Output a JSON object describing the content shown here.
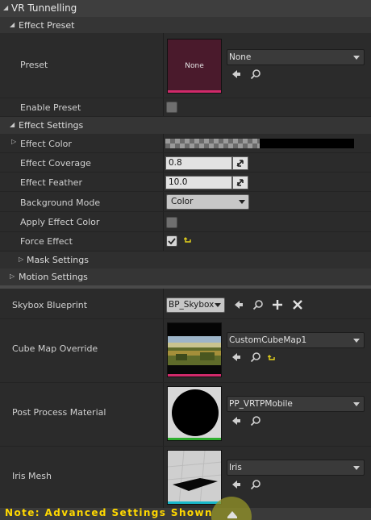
{
  "title": "VR Tunnelling",
  "sections": {
    "effect_preset": "Effect Preset",
    "effect_settings": "Effect Settings",
    "mask_settings": "Mask Settings",
    "motion_settings": "Motion Settings"
  },
  "preset": {
    "label": "Preset",
    "thumb_text": "None",
    "value": "None"
  },
  "enable_preset": {
    "label": "Enable Preset",
    "checked": false
  },
  "effect_color": {
    "label": "Effect Color",
    "color": "#000000"
  },
  "effect_coverage": {
    "label": "Effect Coverage",
    "value": "0.8"
  },
  "effect_feather": {
    "label": "Effect Feather",
    "value": "10.0"
  },
  "background_mode": {
    "label": "Background Mode",
    "value": "Color"
  },
  "apply_effect_color": {
    "label": "Apply Effect Color",
    "checked": false
  },
  "force_effect": {
    "label": "Force Effect",
    "checked": true
  },
  "skybox_blueprint": {
    "label": "Skybox Blueprint",
    "value": "BP_Skybox"
  },
  "cube_map_override": {
    "label": "Cube Map Override",
    "value": "CustomCubeMap1"
  },
  "post_process_material": {
    "label": "Post Process Material",
    "value": "PP_VRTPMobile"
  },
  "iris_mesh": {
    "label": "Iris Mesh",
    "value": "Iris"
  },
  "note": "Note: Advanced Settings Shown",
  "colors": {
    "preset_thumb_bg": "#4a1a2c",
    "preset_thumb_bar": "#d02a6a",
    "cubemap_bar": "#d02a6a",
    "material_bar": "#2fae2f",
    "mesh_bar": "#18b7c9",
    "note_text": "#ffd800",
    "reset_arrow": "#e8d51c"
  }
}
